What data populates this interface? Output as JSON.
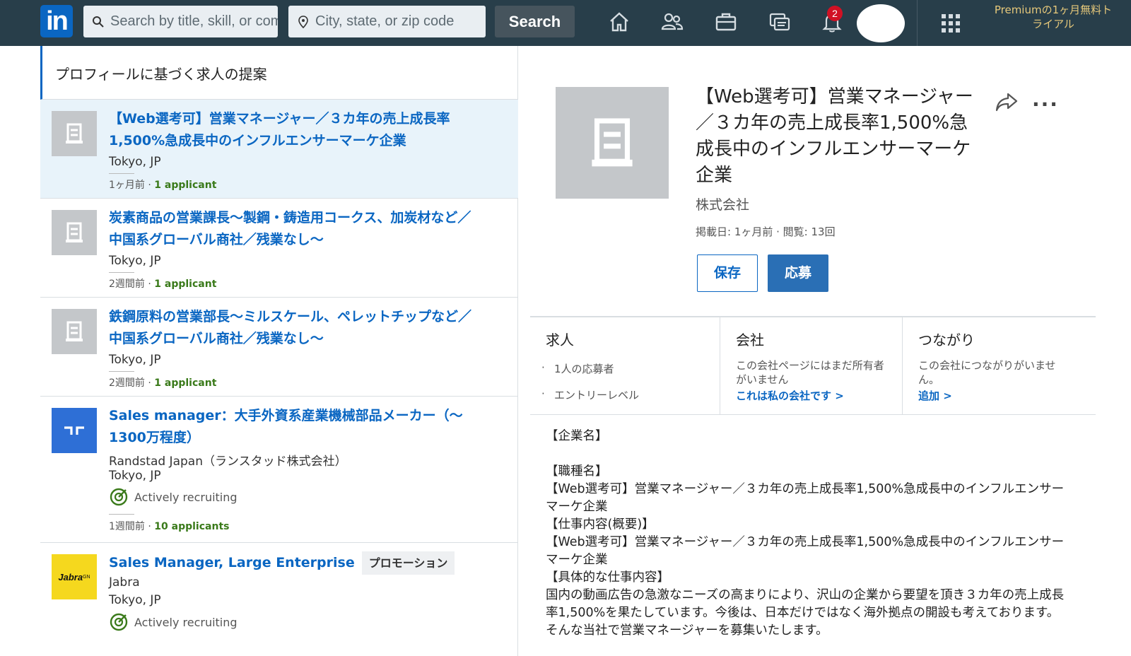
{
  "nav": {
    "logo": "in",
    "keyword_placeholder": "Search by title, skill, or company",
    "location_placeholder": "City, state, or zip code",
    "search_label": "Search",
    "notification_count": "2",
    "premium": "Premiumの1ヶ月無料トライアル",
    "icons": [
      "home-icon",
      "network-icon",
      "jobs-icon",
      "messaging-icon",
      "notifications-icon",
      "grid-icon"
    ]
  },
  "list": {
    "header": "プロフィールに基づく求人の提案",
    "jobs": [
      {
        "title": "【Web選考可】営業マネージャー／３カ年の売上成長率1,500%急成長中のインフルエンサーマーケ企業",
        "company": "",
        "location": "Tokyo, JP",
        "time": "1ヶ月前",
        "applicants": "1 applicant"
      },
      {
        "title": "炭素商品の営業課長〜製鋼・鋳造用コークス、加炭材など／中国系グローバル商社／残業なし〜",
        "company": "",
        "location": "Tokyo, JP",
        "time": "2週間前",
        "applicants": "1 applicant"
      },
      {
        "title": "鉄鋼原料の営業部長〜ミルスケール、ペレットチップなど／中国系グローバル商社／残業なし〜",
        "company": "",
        "location": "Tokyo, JP",
        "time": "2週間前",
        "applicants": "1 applicant"
      },
      {
        "title": "Sales manager：大手外資系産業機械部品メーカー（〜1300万程度）",
        "company": "Randstad Japan（ランスタッド株式会社）",
        "location": "Tokyo, JP",
        "recruiting": "Actively recruiting",
        "time": "1週間前",
        "applicants": "10 applicants"
      },
      {
        "title": "Sales Manager, Large Enterprise",
        "promo": "プロモーション",
        "company": "Jabra",
        "logo_text": "Jabra",
        "logo_sup": "GN",
        "location": "Tokyo, JP",
        "recruiting": "Actively recruiting"
      }
    ]
  },
  "detail": {
    "title": "【Web選考可】営業マネージャー／３カ年の売上成長率1,500%急成長中のインフルエンサーマーケ企業",
    "company": "株式会社",
    "meta": "掲載日: 1ヶ月前 · 閲覧: 13回",
    "save_label": "保存",
    "apply_label": "応募",
    "more_label": "···",
    "jobs_col": {
      "heading": "求人",
      "items": [
        "1人の応募者",
        "エントリーレベル"
      ]
    },
    "company_col": {
      "heading": "会社",
      "text": "この会社ページにはまだ所有者がいません",
      "link": "これは私の会社です >"
    },
    "connections_col": {
      "heading": "つながり",
      "text": "この会社につながりがいません。",
      "link": "追加 >"
    },
    "description": [
      "【企業名】",
      "",
      "【職種名】",
      "【Web選考可】営業マネージャー／３カ年の売上成長率1,500%急成長中のインフルエンサーマーケ企業",
      "【仕事内容(概要)】",
      "【Web選考可】営業マネージャー／３カ年の売上成長率1,500%急成長中のインフルエンサーマーケ企業",
      "【具体的な仕事内容】",
      "国内の動画広告の急激なニーズの高まりにより、沢山の企業から要望を頂き３カ年の売上成長率1,500%を果たしています。今後は、日本だけではなく海外拠点の開設も考えております。そんな当社で営業マネージャーを募集いたします。"
    ]
  },
  "colors": {
    "nav_bg": "#283e4a",
    "brand_blue": "#0a66c2",
    "active_bg": "#e8f3fa",
    "applicant_green": "#3a7a1a",
    "premium_gold": "#e6c87a",
    "badge_red": "#d11124"
  }
}
